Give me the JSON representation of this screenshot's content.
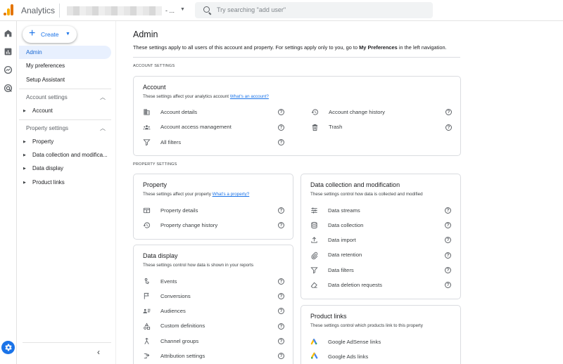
{
  "header": {
    "app_name": "Analytics",
    "account_suffix": "- ...",
    "search_placeholder": "Try searching \"add user\""
  },
  "nav": {
    "create_label": "Create",
    "items": [
      {
        "label": "Admin",
        "active": true
      },
      {
        "label": "My preferences"
      },
      {
        "label": "Setup Assistant"
      }
    ],
    "account_settings": {
      "label": "Account settings",
      "children": [
        "Account"
      ]
    },
    "property_settings": {
      "label": "Property settings",
      "children": [
        "Property",
        "Data collection and modifica...",
        "Data display",
        "Product links"
      ]
    }
  },
  "page": {
    "title": "Admin",
    "desc_start": "These settings apply to all users of this account and property. For settings apply only to you, go to ",
    "desc_bold": "My Preferences",
    "desc_end": " in the left navigation.",
    "account_section": "ACCOUNT SETTINGS",
    "property_section": "PROPERTY SETTINGS"
  },
  "account_card": {
    "title": "Account",
    "desc": "These settings affect your analytics account ",
    "link": "What's an account?",
    "left_items": [
      "Account details",
      "Account access management",
      "All filters"
    ],
    "right_items": [
      "Account change history",
      "Trash"
    ]
  },
  "property_card": {
    "title": "Property",
    "desc": "These settings affect your property ",
    "link": "What's a property?",
    "items": [
      "Property details",
      "Property change history"
    ]
  },
  "data_display_card": {
    "title": "Data display",
    "desc": "These settings control how data is shown in your reports",
    "items": [
      "Events",
      "Conversions",
      "Audiences",
      "Custom definitions",
      "Channel groups",
      "Attribution settings"
    ]
  },
  "data_collection_card": {
    "title": "Data collection and modification",
    "desc": "These settings control how data is collected and modified",
    "items": [
      "Data streams",
      "Data collection",
      "Data import",
      "Data retention",
      "Data filters",
      "Data deletion requests"
    ]
  },
  "product_links_card": {
    "title": "Product links",
    "desc": "These settings control which products link to this property",
    "items": [
      "Google AdSense links",
      "Google Ads links"
    ]
  },
  "help_glyph": "?",
  "colors": {
    "accent": "#1a73e8",
    "active_bg": "#e8f0fe",
    "logo_orange": "#e37400",
    "logo_yellow": "#f9ab00"
  }
}
